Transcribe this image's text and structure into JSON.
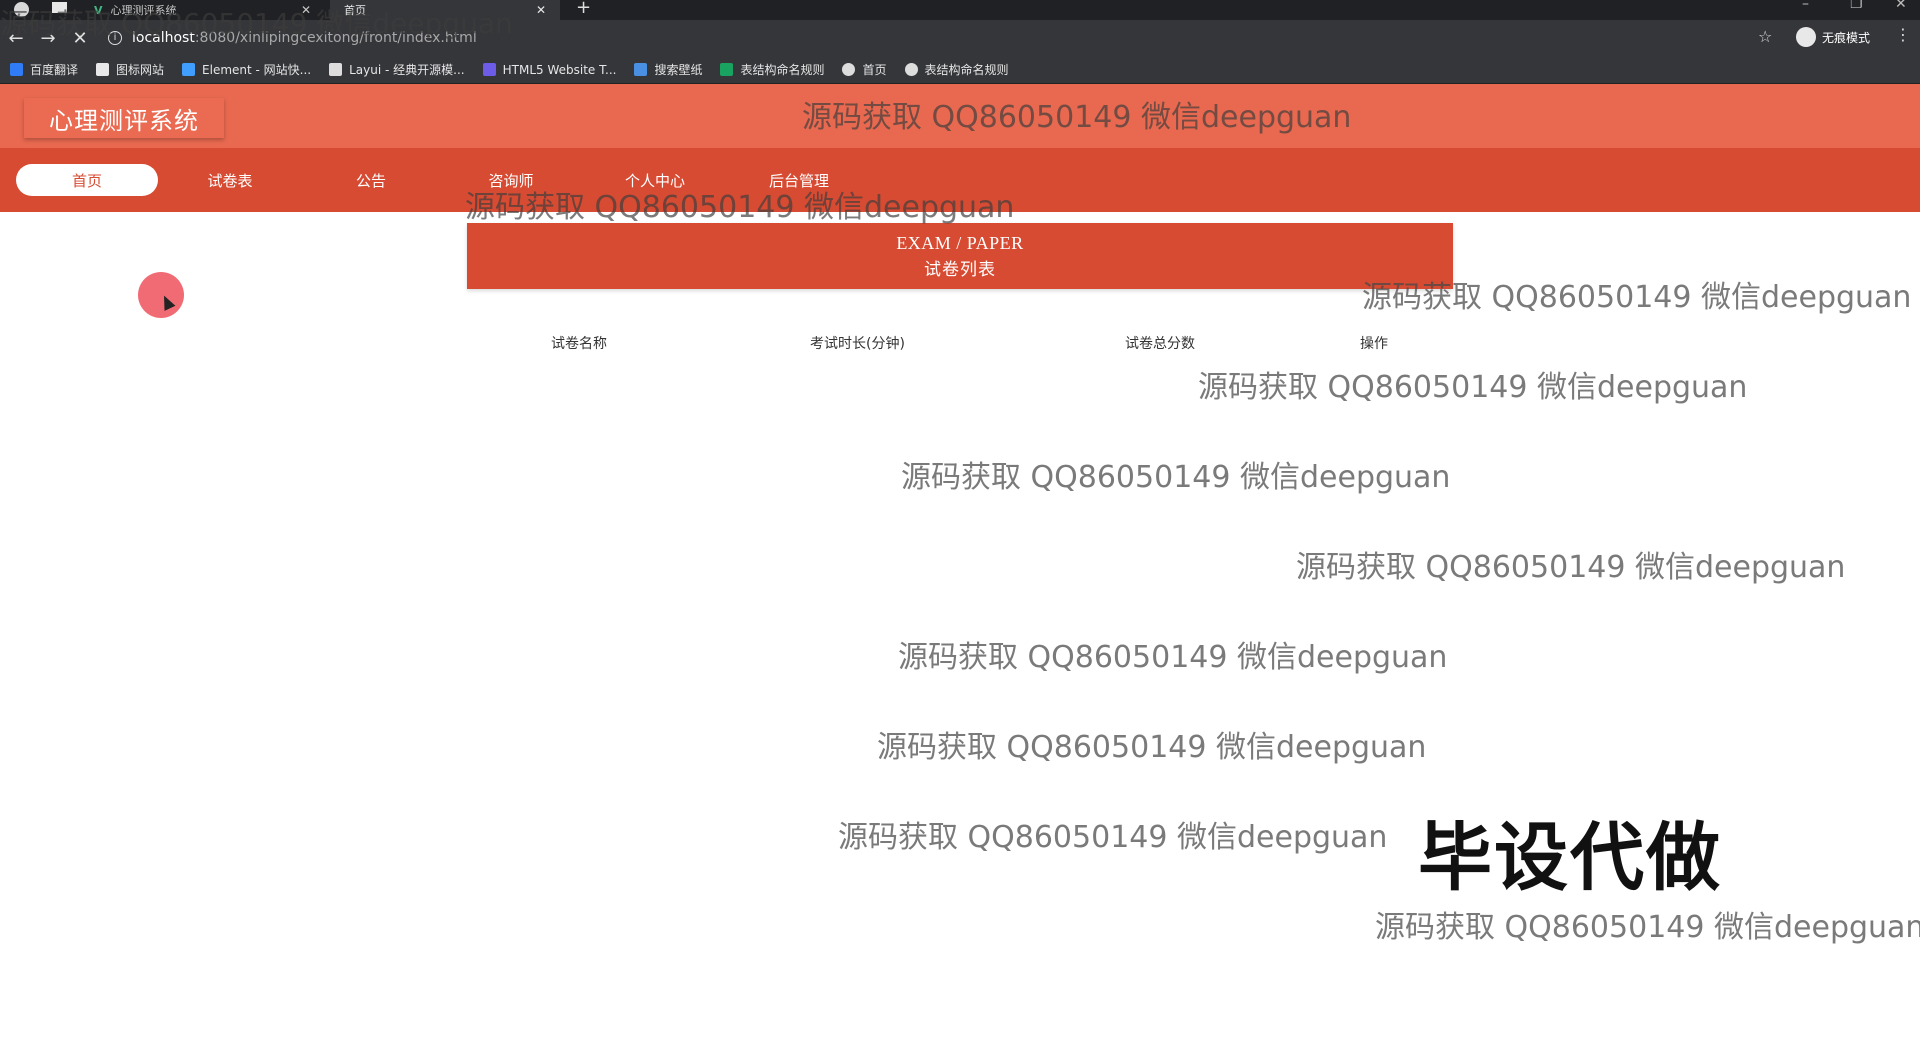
{
  "browser": {
    "tabs": [
      {
        "label": "心理测评系统",
        "active": false
      },
      {
        "label": "首页",
        "active": true
      }
    ],
    "url_host": "localhost",
    "url_path": ":8080/xinlipingcexitong/front/index.html",
    "profile_label": "无痕模式",
    "bookmarks": [
      {
        "label": "百度翻译",
        "icon": "translate-icon",
        "color": "#2f7cf6"
      },
      {
        "label": "图标网站",
        "icon": "flag-icon",
        "color": "#e8e8e8"
      },
      {
        "label": "Element - 网站快...",
        "icon": "element-icon",
        "color": "#409eff"
      },
      {
        "label": "Layui - 经典开源模...",
        "icon": "layui-icon",
        "color": "#dddddd"
      },
      {
        "label": "HTML5 Website T...",
        "icon": "html5-icon",
        "color": "#6c5ce7"
      },
      {
        "label": "搜索壁纸",
        "icon": "wallpaper-icon",
        "color": "#4a90e2"
      },
      {
        "label": "表结构命名规则",
        "icon": "sheet-icon",
        "color": "#1aa260"
      },
      {
        "label": "首页",
        "icon": "globe-icon",
        "color": "#dddddd"
      },
      {
        "label": "表结构命名规则",
        "icon": "globe-icon",
        "color": "#dddddd"
      }
    ]
  },
  "site": {
    "title": "心理测评系统",
    "nav": [
      {
        "label": "首页",
        "active": true
      },
      {
        "label": "试卷表",
        "active": false
      },
      {
        "label": "公告",
        "active": false
      },
      {
        "label": "咨询师",
        "active": false
      },
      {
        "label": "个人中心",
        "active": false
      },
      {
        "label": "后台管理",
        "active": false
      }
    ],
    "colors": {
      "header": "#e8694f",
      "nav": "#d74b33",
      "accent": "#d74b33"
    }
  },
  "content": {
    "banner_en": "EXAM / PAPER",
    "banner_cn": "试卷列表",
    "columns": [
      "试卷名称",
      "考试时长(分钟)",
      "试卷总分数",
      "操作"
    ]
  },
  "watermark": {
    "text": "源码获取 QQ86050149 微信deepguan",
    "stamp": "毕设代做"
  }
}
